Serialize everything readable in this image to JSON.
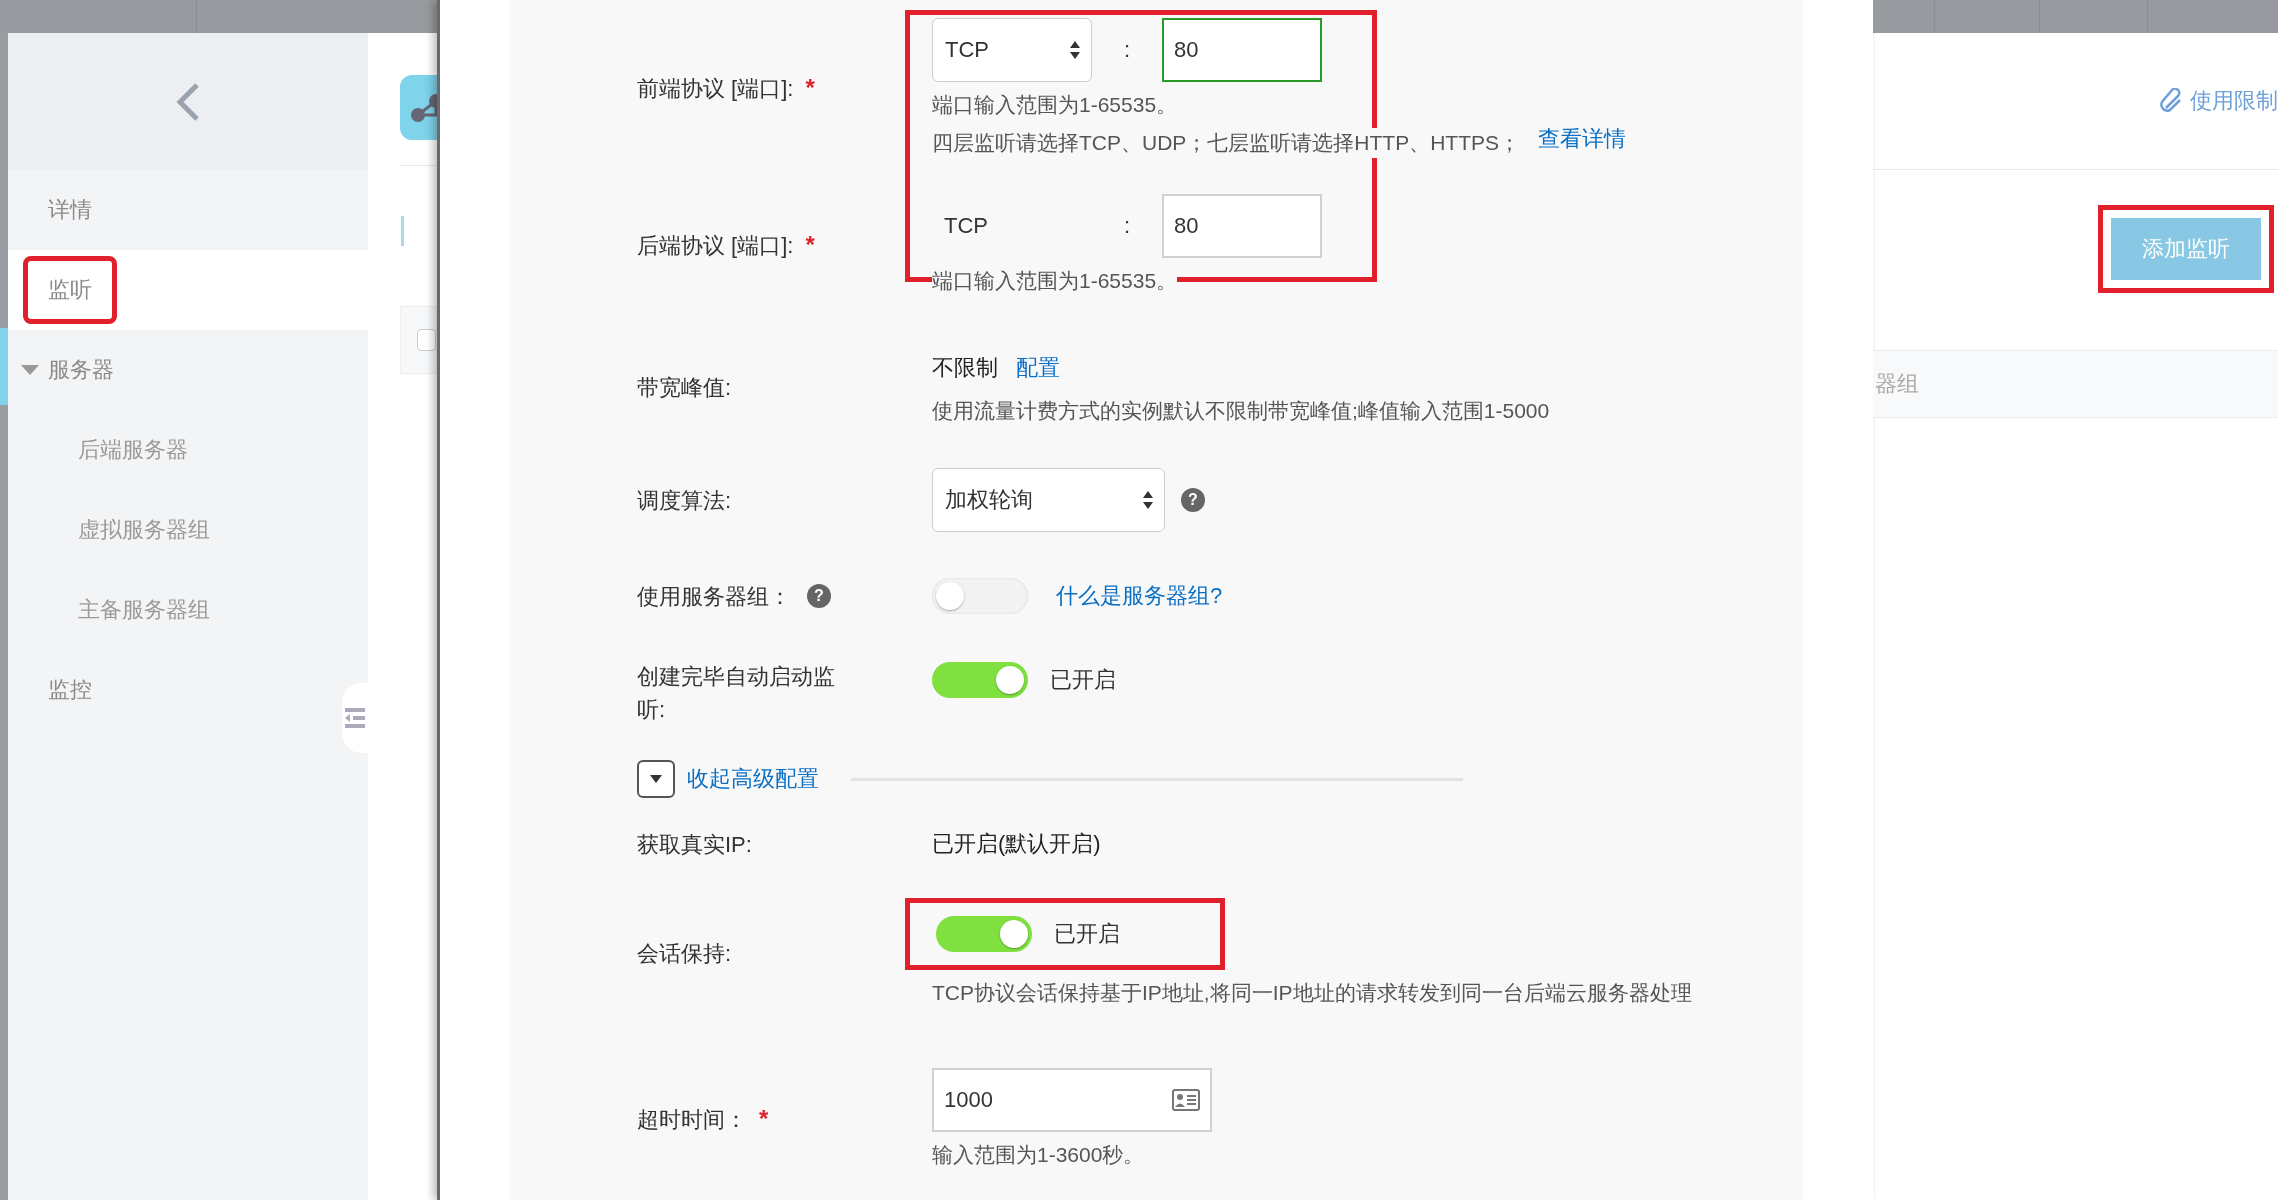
{
  "sidebar": {
    "items": [
      {
        "label": "详情",
        "selected": false,
        "highlighted": false
      },
      {
        "label": "监听",
        "selected": true,
        "highlighted": true
      },
      {
        "label": "服务器",
        "selected": false,
        "highlighted": false,
        "expanded": true,
        "children": [
          {
            "label": "后端服务器",
            "selected": false,
            "highlighted": false
          },
          {
            "label": "虚拟服务器组",
            "selected": false,
            "highlighted": false
          },
          {
            "label": "主备服务器组",
            "selected": false,
            "highlighted": false
          }
        ]
      },
      {
        "label": "监控",
        "selected": false,
        "highlighted": false
      }
    ]
  },
  "page_header": {
    "link": "使用限制"
  },
  "toolbar": {
    "add_button": {
      "label": "添加监听",
      "highlighted": true
    }
  },
  "table": {
    "select_all": {
      "checked": false
    },
    "columns": [
      "器组"
    ]
  },
  "form": {
    "port_rows_highlighted": true,
    "rows": [
      {
        "kind": "port",
        "label": "前端协议 [端口]:",
        "required_mark": "*",
        "protocol": "TCP",
        "protocol_select": true,
        "separator": ":",
        "port": "80",
        "focused": true,
        "hints": [
          {
            "text": "端口输入范围为1-65535。"
          },
          {
            "text": "四层监听请选择TCP、UDP；七层监听请选择HTTP、HTTPS；",
            "link": "查看详情"
          }
        ]
      },
      {
        "kind": "port",
        "label": "后端协议 [端口]:",
        "required_mark": "*",
        "protocol": "TCP",
        "protocol_select": false,
        "separator": ":",
        "port": "80",
        "focused": false,
        "hints": [
          {
            "text": "端口输入范围为1-65535。"
          }
        ]
      },
      {
        "kind": "value",
        "label": "带宽峰值:",
        "value": "不限制",
        "link": "配置",
        "hints": [
          {
            "text": "使用流量计费方式的实例默认不限制带宽峰值;峰值输入范围1-5000"
          }
        ]
      },
      {
        "kind": "select",
        "label": "调度算法:",
        "value": "加权轮询",
        "help": "?"
      },
      {
        "kind": "toggle",
        "label": "使用服务器组：",
        "label_help": "?",
        "on": false,
        "link": "什么是服务器组?"
      },
      {
        "kind": "toggle",
        "label": "创建完毕自动启动监听:",
        "on": true,
        "status": "已开启"
      },
      {
        "kind": "section",
        "label": "收起高级配置",
        "expanded": true
      },
      {
        "kind": "value",
        "label": "获取真实IP:",
        "value": "已开启(默认开启)"
      },
      {
        "kind": "toggle",
        "label": "会话保持:",
        "on": true,
        "status": "已开启",
        "highlighted": true,
        "hints": [
          {
            "text": "TCP协议会话保持基于IP地址,将同一IP地址的请求转发到同一台后端云服务器处理"
          }
        ]
      },
      {
        "kind": "input",
        "label": "超时时间：",
        "required_mark": "*",
        "value": "1000",
        "hints": [
          {
            "text": "输入范围为1-3600秒。"
          }
        ]
      }
    ]
  }
}
